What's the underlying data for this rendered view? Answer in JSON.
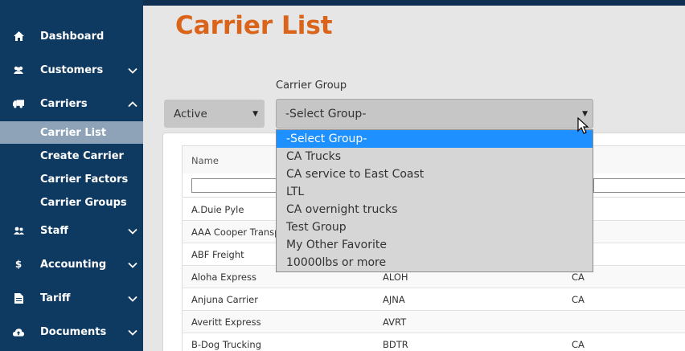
{
  "page": {
    "title": "Carrier List"
  },
  "sidebar": {
    "items": [
      {
        "label": "Dashboard",
        "icon": "home-icon",
        "expanded": null
      },
      {
        "label": "Customers",
        "icon": "users-icon",
        "expanded": false
      },
      {
        "label": "Carriers",
        "icon": "truck-icon",
        "expanded": true
      },
      {
        "label": "Staff",
        "icon": "staff-icon",
        "expanded": false
      },
      {
        "label": "Accounting",
        "icon": "dollar-icon",
        "expanded": false
      },
      {
        "label": "Tariff",
        "icon": "document-icon",
        "expanded": false
      },
      {
        "label": "Documents",
        "icon": "cloud-upload-icon",
        "expanded": false
      }
    ],
    "carrier_sub": [
      {
        "label": "Carrier List",
        "active": true
      },
      {
        "label": "Create Carrier",
        "active": false
      },
      {
        "label": "Carrier Factors",
        "active": false
      },
      {
        "label": "Carrier Groups",
        "active": false
      }
    ]
  },
  "filters": {
    "status_value": "Active",
    "group_label": "Carrier Group",
    "group_value": "-Select Group-",
    "group_options": [
      "-Select Group-",
      "CA Trucks",
      "CA service to East Coast",
      "LTL",
      "CA overnight trucks",
      "Test Group",
      "My Other Favorite",
      "10000lbs or more"
    ]
  },
  "table": {
    "header_name": "Name",
    "rows": [
      {
        "name": "A.Duie Pyle",
        "code": "",
        "state": ""
      },
      {
        "name": "AAA Cooper Transportation",
        "code": "",
        "state": ""
      },
      {
        "name": "ABF Freight",
        "code": "",
        "state": ""
      },
      {
        "name": "Aloha Express",
        "code": "ALOH",
        "state": "CA"
      },
      {
        "name": "Anjuna Carrier",
        "code": "AJNA",
        "state": "CA"
      },
      {
        "name": "Averitt Express",
        "code": "AVRT",
        "state": ""
      },
      {
        "name": "B-Dog Trucking",
        "code": "BDTR",
        "state": "CA"
      }
    ]
  },
  "colors": {
    "sidebar": "#0e3a62",
    "title": "#d9641a",
    "selected_option": "#1e90ff"
  }
}
